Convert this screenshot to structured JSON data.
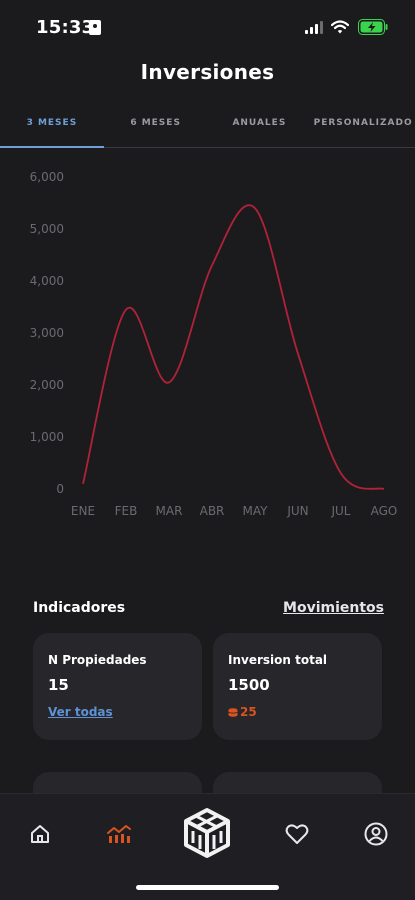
{
  "status_bar": {
    "time": "15:33"
  },
  "header": {
    "title": "Inversiones"
  },
  "tabs": [
    {
      "label": "3 MESES",
      "active": true
    },
    {
      "label": "6 MESES",
      "active": false
    },
    {
      "label": "ANUALES",
      "active": false
    },
    {
      "label": "PERSONALIZADO",
      "active": false
    }
  ],
  "chart_data": {
    "type": "line",
    "categories": [
      "ENE",
      "FEB",
      "MAR",
      "ABR",
      "MAY",
      "JUN",
      "JUL",
      "AGO"
    ],
    "y_ticks": [
      "0",
      "1,000",
      "2,000",
      "3,000",
      "4,000",
      "5,000",
      "6,000"
    ],
    "series": [
      {
        "values": [
          100,
          3450,
          2050,
          4300,
          5400,
          2600,
          300,
          0
        ]
      }
    ],
    "ylim": [
      0,
      6000
    ],
    "line_color": "#b0223a",
    "grid": false
  },
  "indicators": {
    "title": "Indicadores",
    "link": "Movimientos",
    "cards": [
      {
        "label": "N Propiedades",
        "value": "15",
        "link": "Ver todas"
      },
      {
        "label": "Inversion total",
        "value": "1500",
        "sub_value": "25"
      }
    ]
  },
  "nav": {
    "items": [
      "home-icon",
      "chart-icon",
      "logo-icon",
      "heart-icon",
      "profile-icon"
    ],
    "active": "chart-icon",
    "active_color": "#d9541e"
  }
}
